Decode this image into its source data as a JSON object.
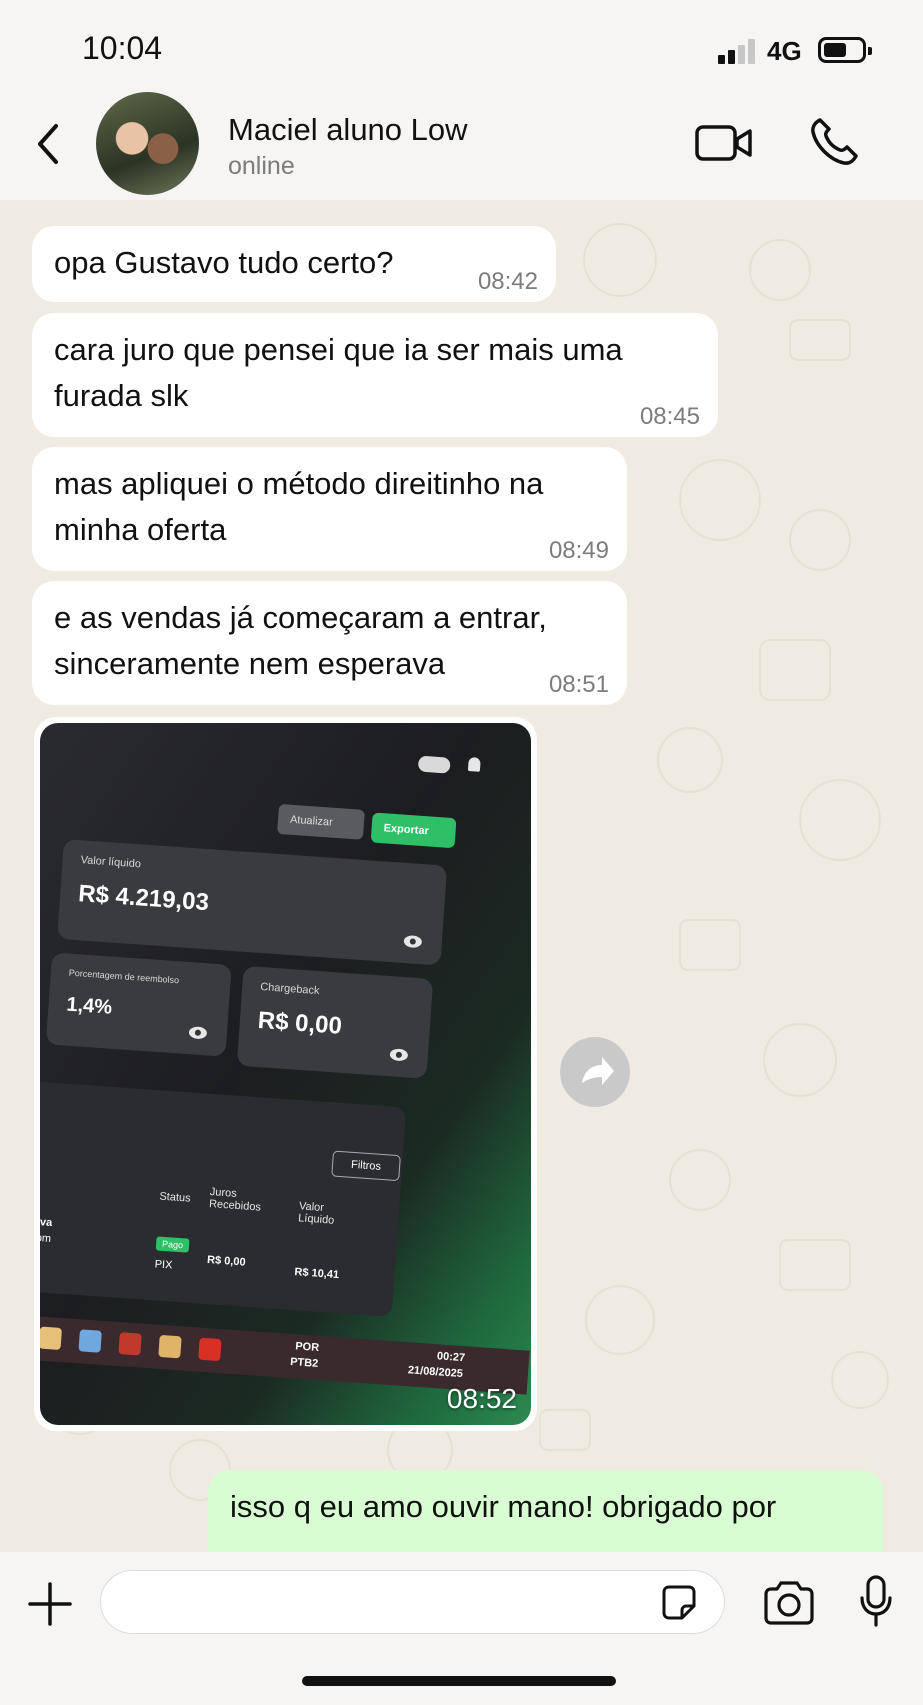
{
  "status_bar": {
    "time": "10:04",
    "network": "4G"
  },
  "header": {
    "contact_name": "Maciel aluno Low",
    "contact_status": "online"
  },
  "messages": [
    {
      "text_lines": [
        "opa Gustavo tudo certo?"
      ],
      "time": "08:42"
    },
    {
      "text_lines": [
        "cara juro que pensei que ia ser mais uma",
        "furada slk"
      ],
      "time": "08:45"
    },
    {
      "text_lines": [
        "mas apliquei o método direitinho na",
        "minha oferta"
      ],
      "time": "08:49"
    },
    {
      "text_lines": [
        "e as vendas já começaram a entrar,",
        "sinceramente nem esperava"
      ],
      "time": "08:51"
    }
  ],
  "media_message": {
    "time": "08:52",
    "screenshot": {
      "btn_atualizar": "Atualizar",
      "btn_exportar": "Exportar",
      "card_valor_liquido": {
        "label": "Valor líquido",
        "value": "R$ 4.219,03"
      },
      "card_reembolso": {
        "label": "Porcentagem de reembolso",
        "value": "1,4%"
      },
      "card_chargeback": {
        "label": "Chargeback",
        "value": "R$ 0,00"
      },
      "filtros": "Filtros",
      "columns": [
        "Status",
        "Juros Recebidos",
        "Valor Líquido"
      ],
      "row": {
        "name": "e Silva",
        "email": "ail.com",
        "status": "Pago",
        "method": "PIX",
        "juros": "R$ 0,00",
        "valor": "R$ 10,41"
      },
      "taskbar": {
        "lang": "POR",
        "layout": "PTB2",
        "clock_time": "00:27",
        "clock_date": "21/08/2025"
      }
    }
  },
  "outgoing_message": {
    "text": "isso q eu amo ouvir mano! obrigado por"
  },
  "composer": {
    "placeholder": ""
  },
  "colors": {
    "chat_bg": "#efeae2",
    "incoming": "#ffffff",
    "outgoing": "#d9fdd3",
    "accent_green": "#2fbf66"
  },
  "icons": [
    "back-arrow-icon",
    "video-call-icon",
    "phone-icon",
    "forward-icon",
    "plus-icon",
    "sticker-icon",
    "camera-icon",
    "microphone-icon"
  ]
}
